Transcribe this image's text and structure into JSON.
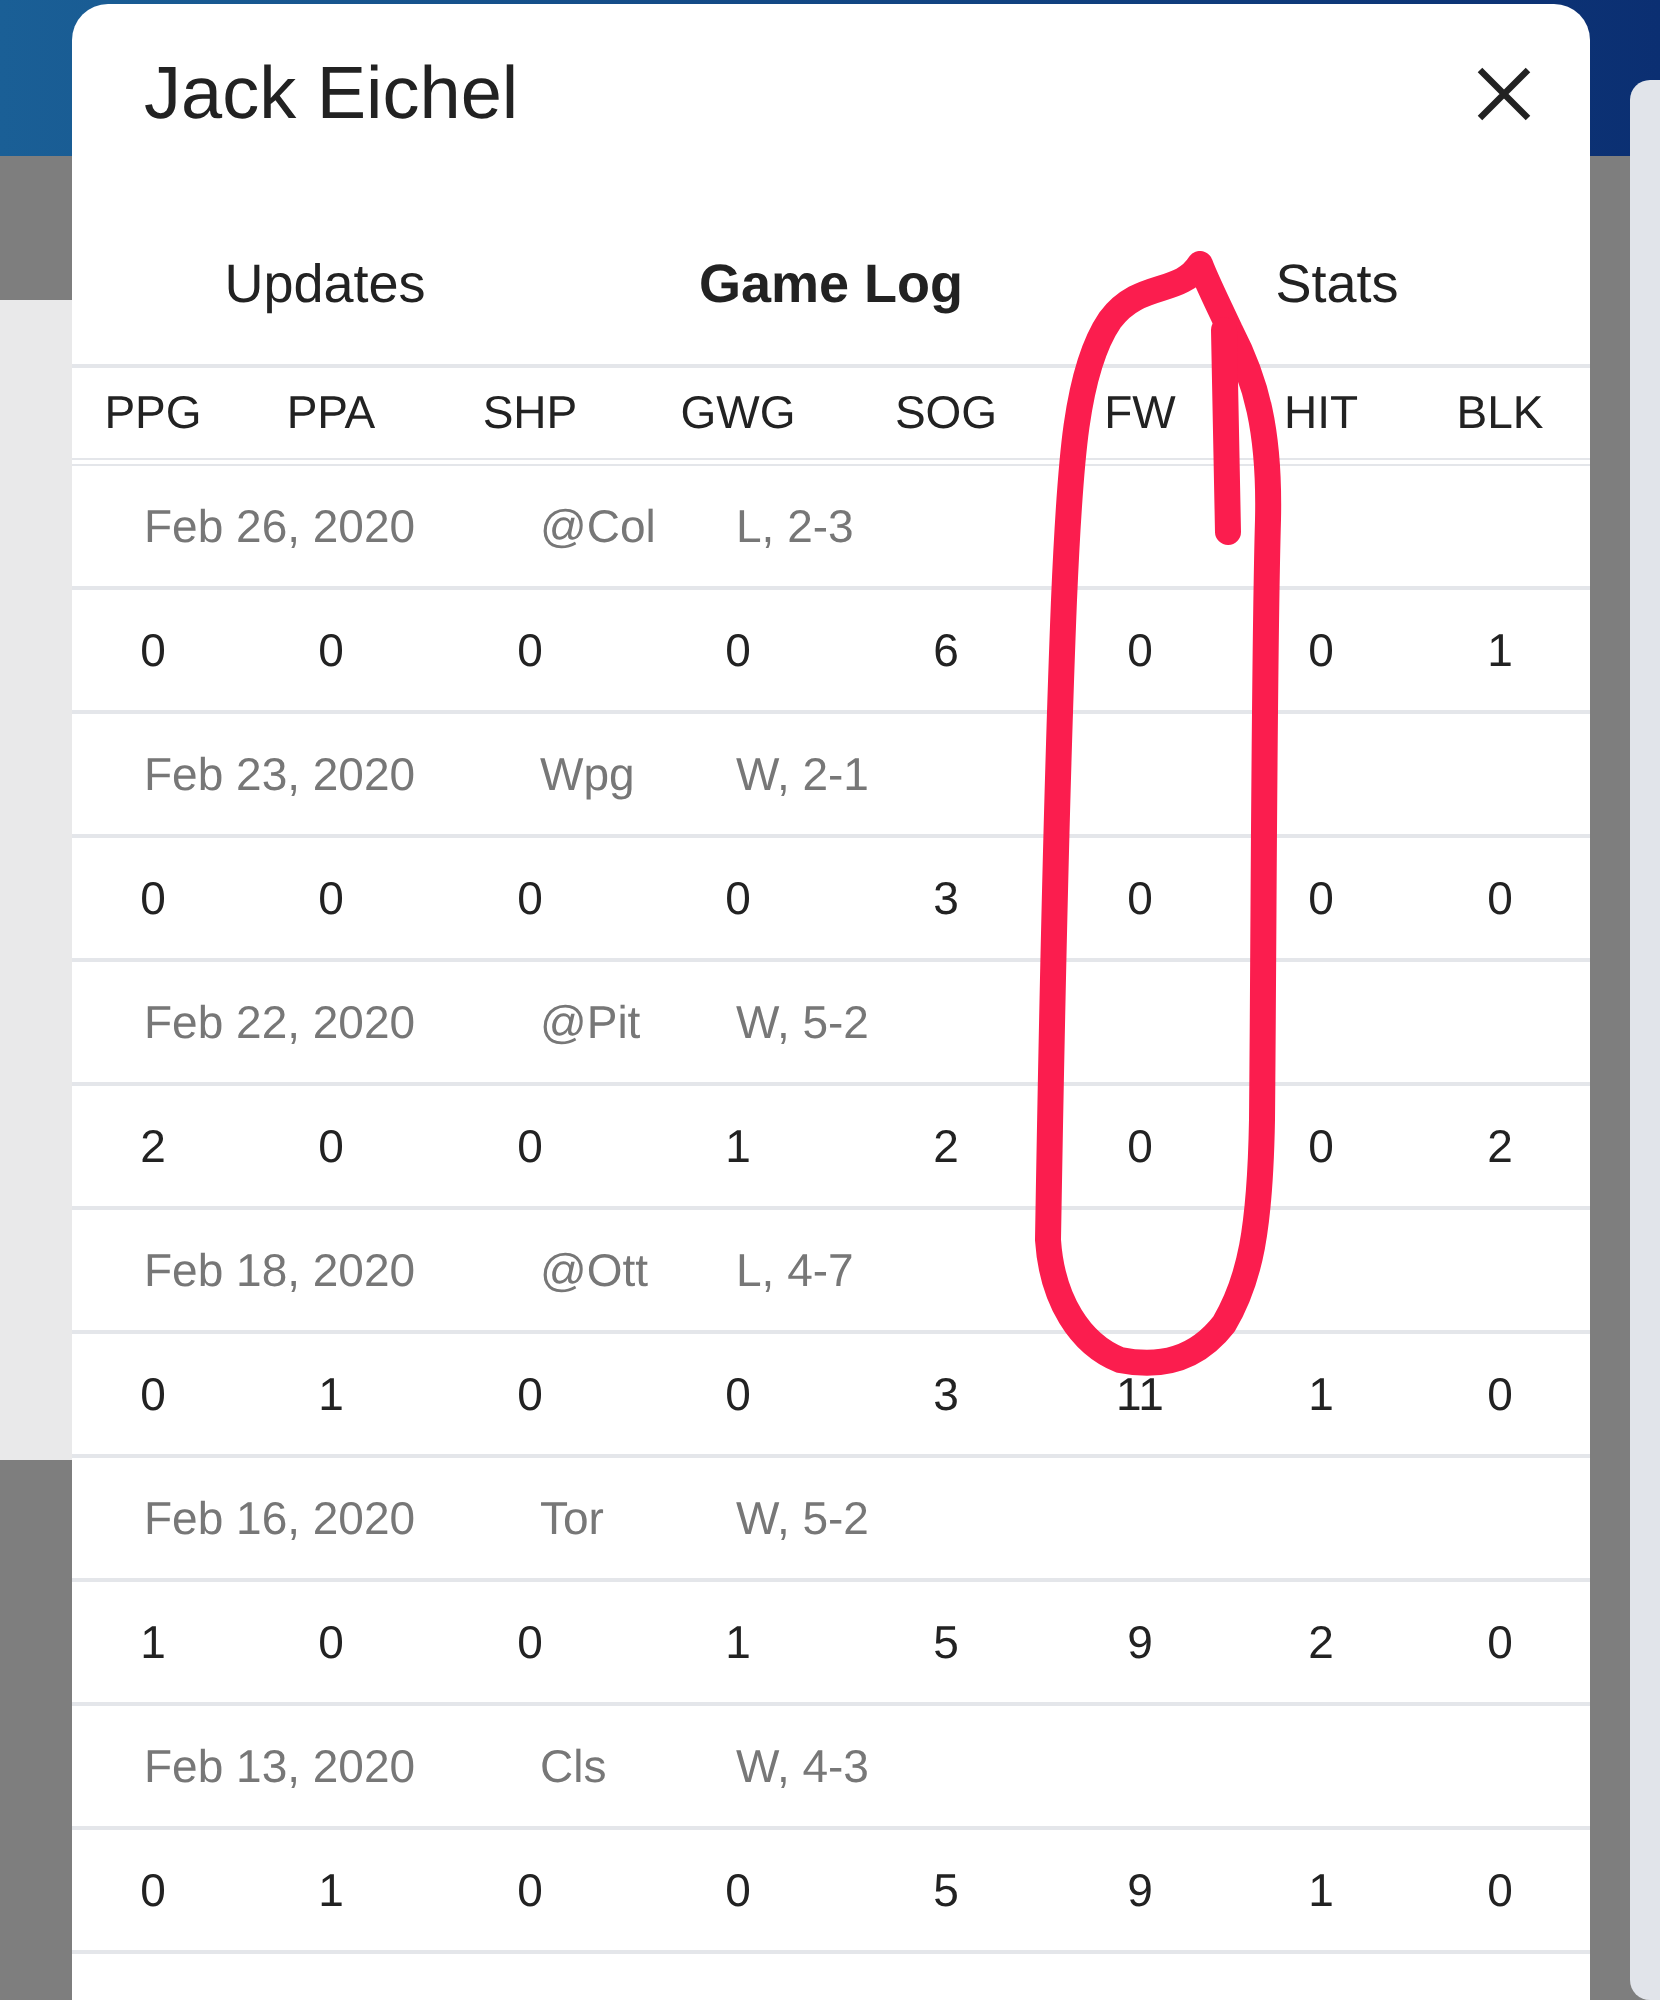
{
  "dialog": {
    "title": "Jack Eichel"
  },
  "tabs": [
    {
      "label": "Updates",
      "selected": false
    },
    {
      "label": "Game Log",
      "selected": true
    },
    {
      "label": "Stats",
      "selected": false
    }
  ],
  "table": {
    "columns": [
      "PPG",
      "PPA",
      "SHP",
      "GWG",
      "SOG",
      "FW",
      "HIT",
      "BLK"
    ],
    "games": [
      {
        "date": "Feb 26, 2020",
        "opponent": "@Col",
        "result": "L, 2-3",
        "stats": [
          "0",
          "0",
          "0",
          "0",
          "6",
          "0",
          "0",
          "1"
        ]
      },
      {
        "date": "Feb 23, 2020",
        "opponent": "Wpg",
        "result": "W, 2-1",
        "stats": [
          "0",
          "0",
          "0",
          "0",
          "3",
          "0",
          "0",
          "0"
        ]
      },
      {
        "date": "Feb 22, 2020",
        "opponent": "@Pit",
        "result": "W, 5-2",
        "stats": [
          "2",
          "0",
          "0",
          "1",
          "2",
          "0",
          "0",
          "2"
        ]
      },
      {
        "date": "Feb 18, 2020",
        "opponent": "@Ott",
        "result": "L, 4-7",
        "stats": [
          "0",
          "1",
          "0",
          "0",
          "3",
          "11",
          "1",
          "0"
        ]
      },
      {
        "date": "Feb 16, 2020",
        "opponent": "Tor",
        "result": "W, 5-2",
        "stats": [
          "1",
          "0",
          "0",
          "1",
          "5",
          "9",
          "2",
          "0"
        ]
      },
      {
        "date": "Feb 13, 2020",
        "opponent": "Cls",
        "result": "W, 4-3",
        "stats": [
          "0",
          "1",
          "0",
          "0",
          "5",
          "9",
          "1",
          "0"
        ]
      }
    ]
  }
}
